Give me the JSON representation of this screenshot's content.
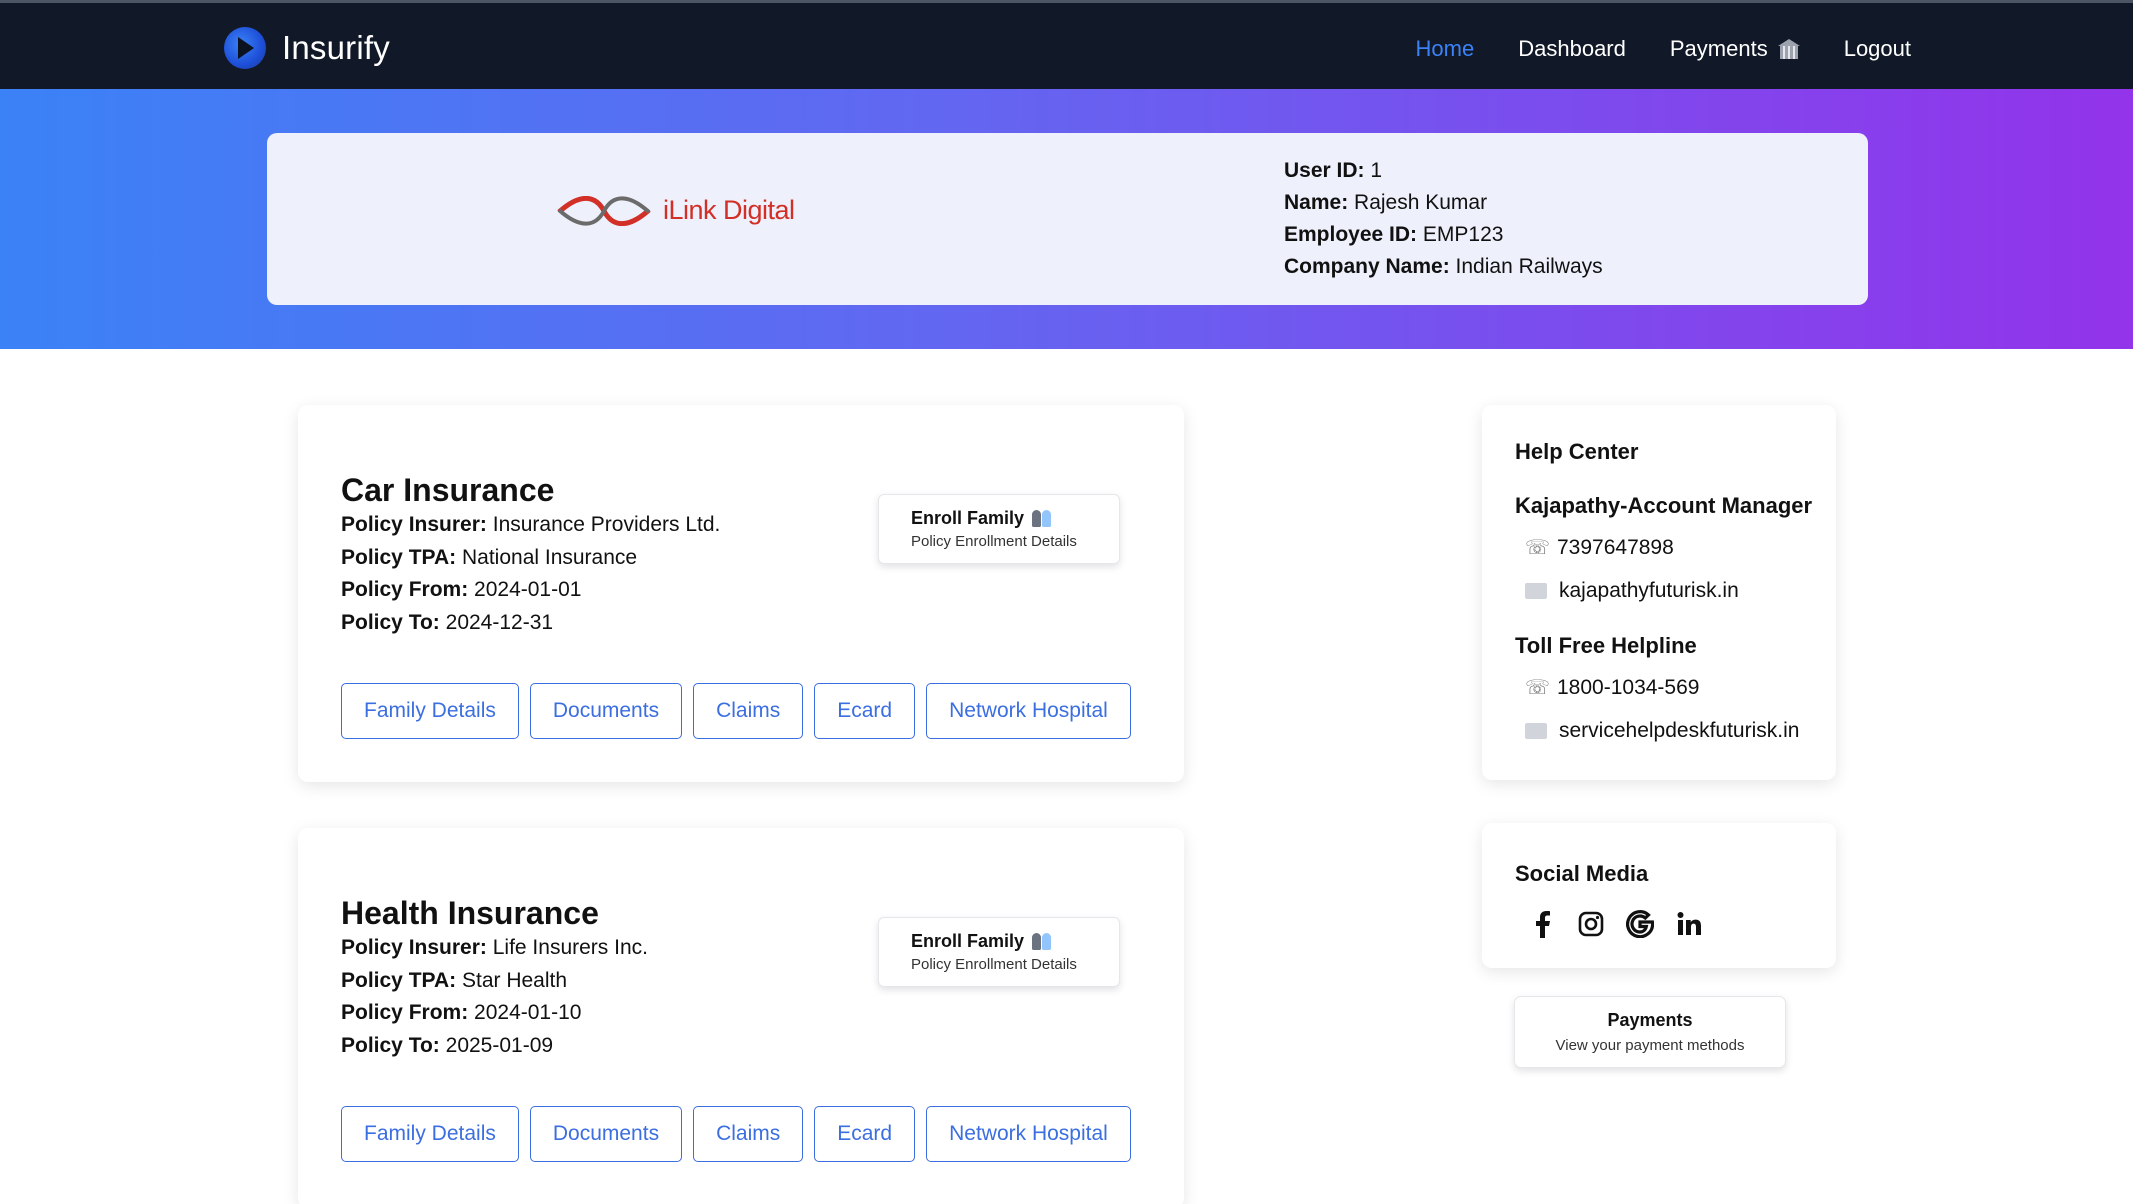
{
  "nav": {
    "brand": "Insurify",
    "links": [
      {
        "label": "Home",
        "active": true
      },
      {
        "label": "Dashboard",
        "active": false
      },
      {
        "label": "Payments",
        "active": false,
        "icon": "bank-icon"
      },
      {
        "label": "Logout",
        "active": false
      }
    ]
  },
  "profile": {
    "company_logo_text": "iLink Digital",
    "user_id_label": "User ID:",
    "user_id": "1",
    "name_label": "Name:",
    "name": "Rajesh Kumar",
    "employee_id_label": "Employee ID:",
    "employee_id": "EMP123",
    "company_label": "Company Name:",
    "company": "Indian Railways"
  },
  "policies": [
    {
      "title": "Car Insurance",
      "insurer_label": "Policy Insurer:",
      "insurer": "Insurance Providers Ltd.",
      "tpa_label": "Policy TPA:",
      "tpa": "National Insurance",
      "from_label": "Policy From:",
      "from": "2024-01-01",
      "to_label": "Policy To:",
      "to": "2024-12-31",
      "enroll_title": "Enroll Family",
      "enroll_sub": "Policy Enrollment Details",
      "buttons": [
        "Family Details",
        "Documents",
        "Claims",
        "Ecard",
        "Network Hospital"
      ]
    },
    {
      "title": "Health Insurance",
      "insurer_label": "Policy Insurer:",
      "insurer": "Life Insurers Inc.",
      "tpa_label": "Policy TPA:",
      "tpa": "Star Health",
      "from_label": "Policy From:",
      "from": "2024-01-10",
      "to_label": "Policy To:",
      "to": "2025-01-09",
      "enroll_title": "Enroll Family",
      "enroll_sub": "Policy Enrollment Details",
      "buttons": [
        "Family Details",
        "Documents",
        "Claims",
        "Ecard",
        "Network Hospital"
      ]
    }
  ],
  "help": {
    "title": "Help Center",
    "manager_title": "Kajapathy-Account Manager",
    "manager_phone": "7397647898",
    "manager_email": "kajapathyfuturisk.in",
    "helpline_title": "Toll Free Helpline",
    "helpline_phone": "1800-1034-569",
    "helpline_email": "servicehelpdeskfuturisk.in"
  },
  "social": {
    "title": "Social Media",
    "icons": [
      "facebook-icon",
      "instagram-icon",
      "google-icon",
      "linkedin-icon"
    ]
  },
  "payments_card": {
    "title": "Payments",
    "subtitle": "View your payment methods"
  },
  "colors": {
    "nav_bg": "#111827",
    "accent": "#3b82f6",
    "gradient_start": "#3b82f6",
    "gradient_end": "#9333ea",
    "button_blue": "#3b6ee0",
    "ilink_red": "#d22f27"
  }
}
